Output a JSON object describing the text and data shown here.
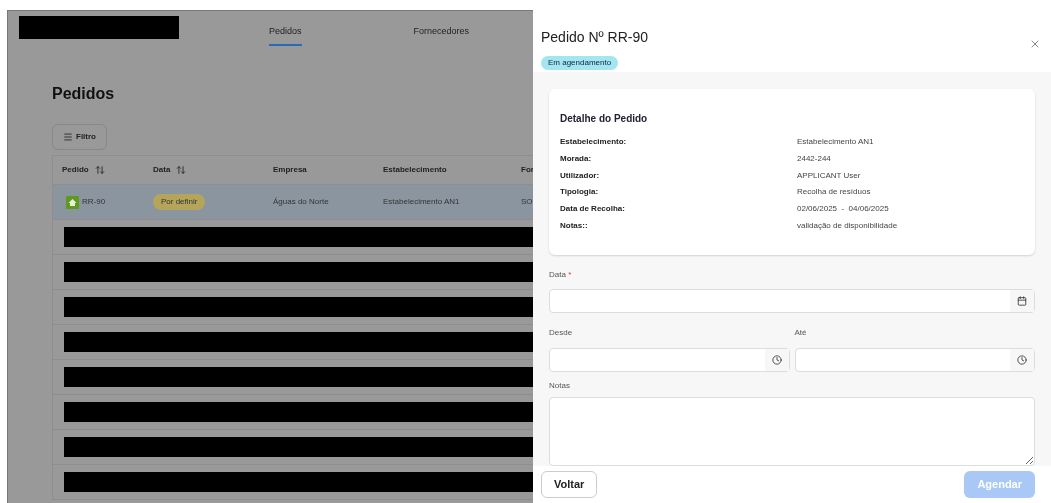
{
  "nav": {
    "tabs": [
      {
        "label": "Pedidos",
        "selected": true
      },
      {
        "label": "Fornecedores",
        "selected": false
      }
    ]
  },
  "page_title": "Pedidos",
  "filter_button": "Filtro",
  "table": {
    "columns": [
      {
        "label": "Pedido",
        "sortable": true
      },
      {
        "label": "Data",
        "sortable": true
      },
      {
        "label": "Empresa",
        "sortable": false
      },
      {
        "label": "Estabelecimento",
        "sortable": false
      },
      {
        "label": "For"
      }
    ],
    "rows": [
      {
        "kind": "data",
        "selected": true,
        "cells": [
          "RR-90",
          "Por definir",
          "Águas do Norte",
          "Estabelecimento AN1",
          "SO"
        ]
      },
      {
        "kind": "redacted"
      },
      {
        "kind": "redacted"
      },
      {
        "kind": "redacted"
      },
      {
        "kind": "redacted"
      },
      {
        "kind": "redacted"
      },
      {
        "kind": "redacted"
      },
      {
        "kind": "redacted"
      },
      {
        "kind": "redacted"
      }
    ]
  },
  "drawer": {
    "title": "Pedido Nº RR-90",
    "status": "Em agendamento",
    "detail": {
      "title": "Detalhe do Pedido",
      "rows": [
        {
          "label": "Estabelecimento:",
          "value": "Estabelecimento AN1"
        },
        {
          "label": "Morada:",
          "value": "2442-244"
        },
        {
          "label": "Utilizador:",
          "value": "APPLICANT User"
        },
        {
          "label": "Tipologia:",
          "value": "Recolha de resíduos"
        },
        {
          "label": "Data de Recolha:",
          "value": "02/06/2025  -  04/06/2025"
        },
        {
          "label": "Notas::",
          "value": "validação de disponibilidade"
        }
      ]
    },
    "date_field": {
      "label": "Data",
      "required": "*"
    },
    "from_field": {
      "label": "Desde"
    },
    "to_field": {
      "label": "Até"
    },
    "notes_field": {
      "label": "Notas"
    },
    "back_button": {
      "label": "Voltar",
      "disabled": false
    },
    "schedule_button": {
      "label": "Agendar",
      "disabled": true
    }
  }
}
